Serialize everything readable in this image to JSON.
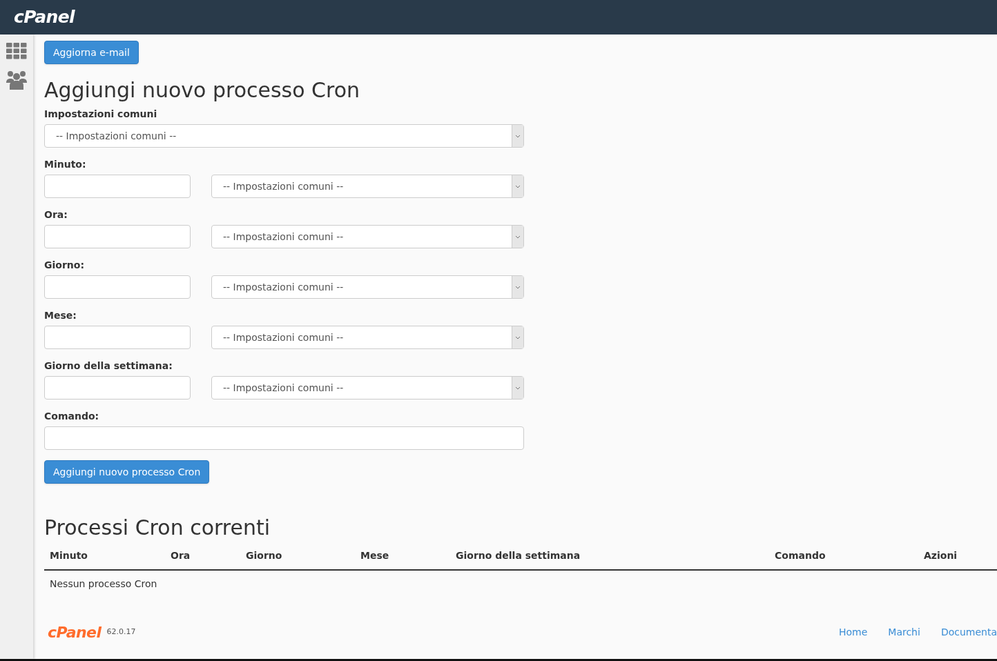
{
  "header": {
    "logo": "cPanel"
  },
  "update_button": "Aggiorna e-mail",
  "form": {
    "title": "Aggiungi nuovo processo Cron",
    "common": {
      "label": "Impostazioni comuni",
      "select": "-- Impostazioni comuni --"
    },
    "fields": [
      {
        "label": "Minuto:",
        "select": "-- Impostazioni comuni --"
      },
      {
        "label": "Ora:",
        "select": "-- Impostazioni comuni --"
      },
      {
        "label": "Giorno:",
        "select": "-- Impostazioni comuni --"
      },
      {
        "label": "Mese:",
        "select": "-- Impostazioni comuni --"
      },
      {
        "label": "Giorno della settimana:",
        "select": "-- Impostazioni comuni --"
      }
    ],
    "command": {
      "label": "Comando:"
    },
    "submit": "Aggiungi nuovo processo Cron"
  },
  "current": {
    "title": "Processi Cron correnti",
    "columns": [
      "Minuto",
      "Ora",
      "Giorno",
      "Mese",
      "Giorno della settimana",
      "Comando",
      "Azioni"
    ],
    "empty": "Nessun processo Cron"
  },
  "footer": {
    "logo": "cPanel",
    "version": "62.0.17",
    "links": [
      "Home",
      "Marchi",
      "Documenta"
    ]
  }
}
